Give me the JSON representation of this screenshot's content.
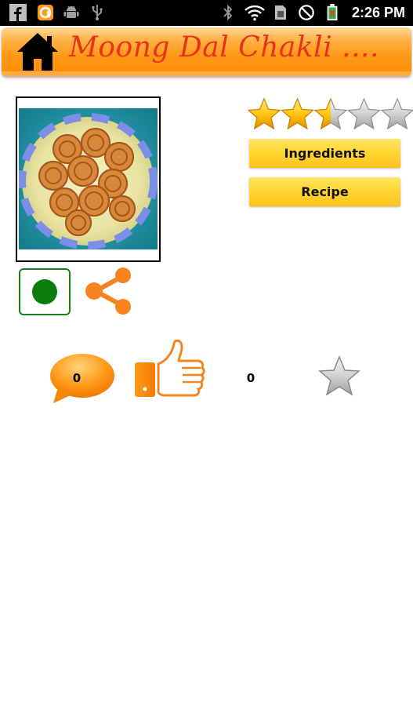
{
  "status_bar": {
    "time": "2:26 PM",
    "icons": [
      "facebook-icon",
      "orange-app-icon",
      "android-icon",
      "usb-icon",
      "bluetooth-icon",
      "wifi-icon",
      "sim-icon",
      "do-not-disturb-icon",
      "battery-charging-icon"
    ]
  },
  "header": {
    "title": "Moong Dal Chakli ....",
    "home_icon": "home-icon"
  },
  "recipe": {
    "image": "chakli-plate-photo",
    "rating": {
      "value": 2.5,
      "max": 5
    },
    "ingredients_label": "Ingredients",
    "recipe_label": "Recipe",
    "veg_indicator": "veg-symbol",
    "share_icon": "share-icon"
  },
  "stats": {
    "comments": "0",
    "likes": "0",
    "comment_icon": "comment-bubble-icon",
    "like_icon": "thumbs-up-icon",
    "favorite_icon": "favorite-star-icon"
  },
  "colors": {
    "header_orange": "#ff9a1a",
    "title_red": "#e8331b",
    "button_yellow": "#ffd633",
    "veg_green": "#0a7d0a",
    "accent_orange": "#f7841e"
  }
}
